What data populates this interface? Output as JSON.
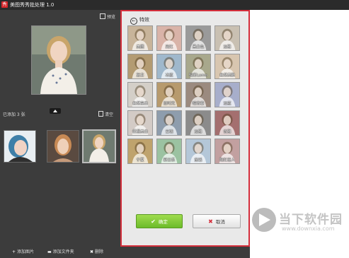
{
  "window": {
    "title": "美图秀秀批处理 1.0",
    "app_icon_glyph": "秀"
  },
  "left_panel": {
    "preview_label": "预览",
    "added_count_label": "已添加 3 张",
    "clear_label": "清空",
    "actions": [
      {
        "label": "添加图片",
        "glyph": "+"
      },
      {
        "label": "添加文件夹",
        "glyph": "▬"
      },
      {
        "label": "删除",
        "glyph": "✖"
      }
    ]
  },
  "effects_panel": {
    "title": "特效",
    "effects": [
      {
        "label": "美图",
        "tint": "#c8b49a"
      },
      {
        "label": "亮红",
        "tint": "#d9b3a8"
      },
      {
        "label": "黑白色",
        "tint": "#9a9a9a"
      },
      {
        "label": "淡雅",
        "tint": "#c9c0b2"
      },
      {
        "label": "复古",
        "tint": "#b39b72"
      },
      {
        "label": "冰蓝",
        "tint": "#9fb8cc"
      },
      {
        "label": "轻彩Lomo",
        "tint": "#a8a88c"
      },
      {
        "label": "自然美肤",
        "tint": "#d8c6b0"
      },
      {
        "label": "自然高白",
        "tint": "#d4cfc8"
      },
      {
        "label": "旧时光",
        "tint": "#b79a6d"
      },
      {
        "label": "暗青春",
        "tint": "#9b8a7f"
      },
      {
        "label": "淡蓝",
        "tint": "#a7aecb"
      },
      {
        "label": "保湿美白",
        "tint": "#d3cbc6"
      },
      {
        "label": "云端",
        "tint": "#8e9dad"
      },
      {
        "label": "淡雅",
        "tint": "#8b8b8b"
      },
      {
        "label": "优雅",
        "tint": "#a46f6f"
      },
      {
        "label": "宁夏",
        "tint": "#bfa36d"
      },
      {
        "label": "新日系",
        "tint": "#9bc2a1"
      },
      {
        "label": "童话",
        "tint": "#b4c7d8"
      },
      {
        "label": "阳红佳人",
        "tint": "#c2a0a0"
      }
    ],
    "ok_label": "确定",
    "cancel_label": "取消"
  },
  "watermark": {
    "title": "当下软件园",
    "url": "www.downxia.com"
  },
  "colors": {
    "accent_red": "#d42e3b",
    "ok_green": "#7dc936",
    "panel_bg": "#e9e9e9",
    "dark_bg": "#3c3c3c"
  }
}
